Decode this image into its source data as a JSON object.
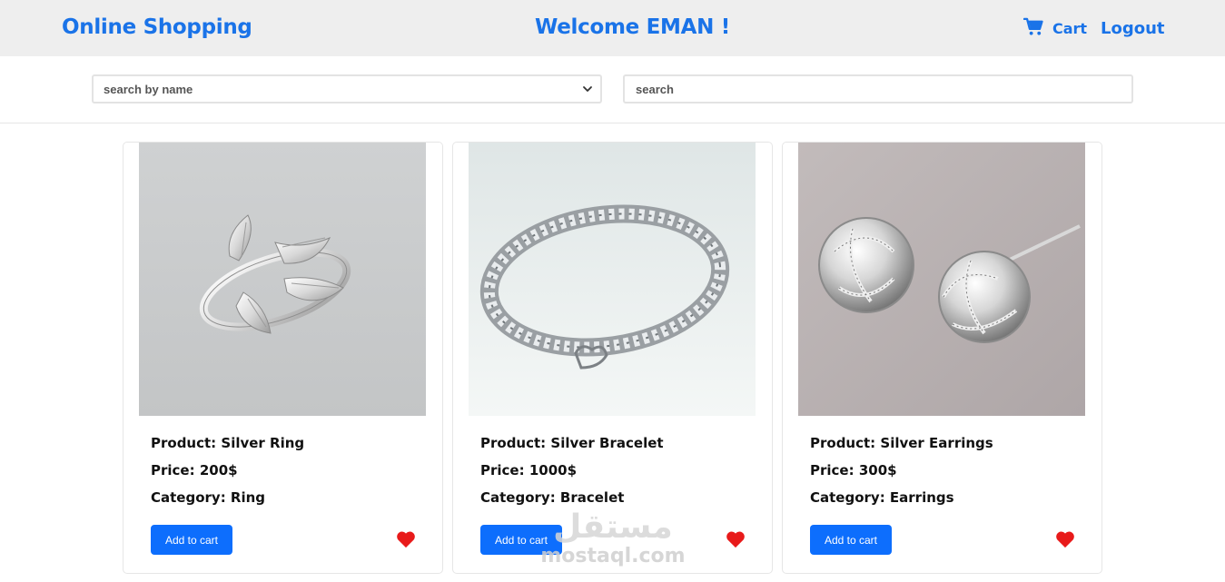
{
  "header": {
    "brand": "Online Shopping",
    "welcome": "Welcome EMAN !",
    "cart_label": "Cart",
    "logout_label": "Logout"
  },
  "filters": {
    "select_value": "search by name",
    "search_placeholder": "search"
  },
  "products": [
    {
      "product": "Product: Silver Ring",
      "price": "Price: 200$",
      "category": "Category: Ring",
      "button": "Add to cart",
      "image": "silver-ring"
    },
    {
      "product": "Product: Silver Bracelet",
      "price": "Price: 1000$",
      "category": "Category: Bracelet",
      "button": "Add to cart",
      "image": "silver-bracelet"
    },
    {
      "product": "Product: Silver Earrings",
      "price": "Price: 300$",
      "category": "Category: Earrings",
      "button": "Add to cart",
      "image": "silver-earrings"
    }
  ],
  "watermark": {
    "arabic": "مستقل",
    "latin": "mostaql.com"
  },
  "colors": {
    "accent": "#1a73e8",
    "button": "#0d6efd",
    "heart": "#e81a1a",
    "navbar": "#eeeeee"
  },
  "icons": {
    "cart": "cart-icon",
    "heart": "heart-icon",
    "dropdown": "chevron-down-icon"
  }
}
